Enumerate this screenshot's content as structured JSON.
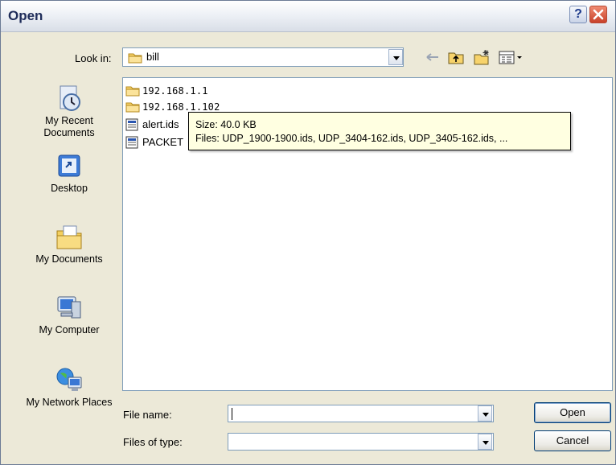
{
  "window": {
    "title": "Open"
  },
  "titlebar_buttons": {
    "help": "?"
  },
  "look_in": {
    "label": "Look in:",
    "value": "bill"
  },
  "toolbar": {
    "icons": [
      "back-arrow-icon",
      "up-one-level-icon",
      "new-folder-icon",
      "view-menu-icon"
    ]
  },
  "places_bar": [
    {
      "label": "My Recent Documents",
      "icon": "recent-documents-icon"
    },
    {
      "label": "Desktop",
      "icon": "desktop-icon"
    },
    {
      "label": "My Documents",
      "icon": "my-documents-icon"
    },
    {
      "label": "My Computer",
      "icon": "my-computer-icon"
    },
    {
      "label": "My Network Places",
      "icon": "network-places-icon"
    }
  ],
  "files": [
    {
      "name": "192.168.1.1",
      "type": "folder"
    },
    {
      "name": "192.168.1.102",
      "type": "folder"
    },
    {
      "name": "alert.ids",
      "type": "ids-file"
    },
    {
      "name": "PACKET",
      "type": "ids-file"
    }
  ],
  "tooltip": {
    "size": "Size: 40.0 KB",
    "files": "Files: UDP_1900-1900.ids, UDP_3404-162.ids, UDP_3405-162.ids, ..."
  },
  "file_name": {
    "label": "File name:",
    "value": ""
  },
  "file_type": {
    "label": "Files of type:",
    "value": ""
  },
  "buttons": {
    "open": "Open",
    "cancel": "Cancel"
  },
  "colors": {
    "title_text": "#1f2d5a",
    "close_button": "#c8412a",
    "tooltip_bg": "#ffffe1",
    "dialog_bg": "#ece9d8"
  }
}
